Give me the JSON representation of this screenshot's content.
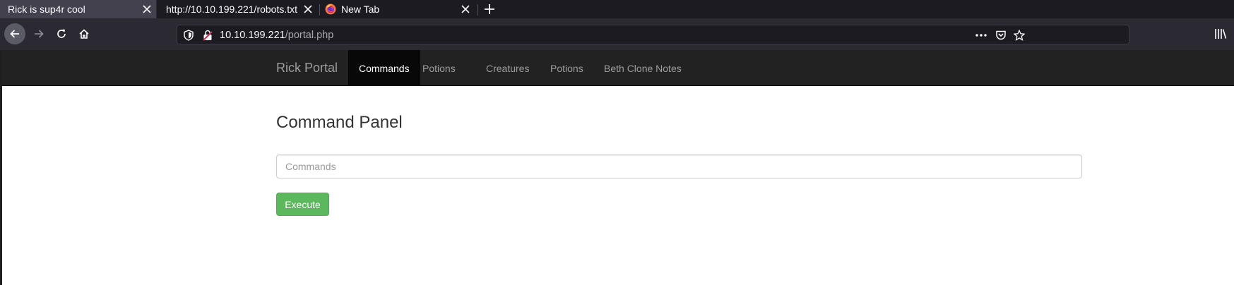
{
  "browser": {
    "tabs": [
      {
        "title": "Rick is sup4r cool",
        "active": true
      },
      {
        "title": "http://10.10.199.221/robots.txt",
        "active": false
      },
      {
        "title": "New Tab",
        "active": false,
        "icon": "firefox-logo"
      }
    ],
    "url": {
      "host": "10.10.199.221",
      "path": "/portal.php"
    },
    "colors": {
      "tab_strip": "#1c1b22",
      "toolbar": "#2b2a33",
      "active_tab": "#42414d"
    }
  },
  "page": {
    "navbar": {
      "brand": "Rick Portal",
      "items": [
        {
          "label": "Commands",
          "active": true
        },
        {
          "label": "Potions",
          "active": false
        },
        {
          "label": "Creatures",
          "active": false
        },
        {
          "label": "Potions",
          "active": false
        },
        {
          "label": "Beth Clone Notes",
          "active": false
        }
      ]
    },
    "title": "Command Panel",
    "command_input": {
      "placeholder": "Commands",
      "value": ""
    },
    "execute_button": "Execute",
    "colors": {
      "navbar": "#222222",
      "active_nav": "#080808",
      "button": "#5cb85c"
    }
  }
}
